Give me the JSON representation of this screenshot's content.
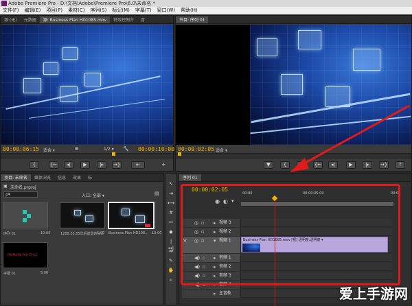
{
  "title": "Adobe Premiere Pro - D:\\文档\\Adobe\\Premiere Pro\\6.0\\未命名 *",
  "menu": [
    "文件(F)",
    "编辑(E)",
    "项目(P)",
    "素材(C)",
    "序列(S)",
    "标记(M)",
    "字幕(T)",
    "窗口(W)",
    "帮助(H)"
  ],
  "source": {
    "tabs": [
      "源:(无)",
      "元数据",
      "源: Business Plan HD1085.mov",
      "特效控制台",
      "音"
    ],
    "timecode_left": "00:00:06:15",
    "fit": "适合",
    "ratio": "1/2",
    "timecode_right": "00:00:10:00"
  },
  "program": {
    "tab": "节目: 序列 01",
    "timecode_left": "00:00:02:05",
    "fit": "适合"
  },
  "project": {
    "tabs": [
      "项目: 未命名",
      "媒体浏览",
      "信息",
      "效果",
      "标"
    ],
    "name": "未命名.prproj",
    "entry_label": "入口: 全部",
    "search": "ρ▾",
    "items": [
      {
        "name": "序列 01",
        "duration": "10:00"
      },
      {
        "name": "1288.35.85年后前景的.avi",
        "duration": "5:00"
      },
      {
        "name": "Business Plan HD108...",
        "duration": "10:00"
      },
      {
        "name": "字幕 01",
        "duration": "5:00"
      }
    ],
    "title_card_text": "PREMIERE PRO STYLE"
  },
  "timeline": {
    "tab": "序列 01",
    "timecode": "00:00:02:05",
    "ruler": [
      "00:00",
      "00:00:05:00",
      "00:00"
    ],
    "video_tracks": [
      "视频 3",
      "视频 2",
      "视频 1"
    ],
    "audio_tracks": [
      "音频 1",
      "音频 2",
      "音频 3",
      "音频 4",
      "主音轨"
    ],
    "clip_label": "Business Plan HD1085.mov [视] 透明度:透明度 ▾"
  },
  "watermark": "爱上手游网",
  "colors": {
    "timecode": "#f0b000",
    "highlight": "#e11a1a",
    "clip": "#b9a6dc"
  }
}
